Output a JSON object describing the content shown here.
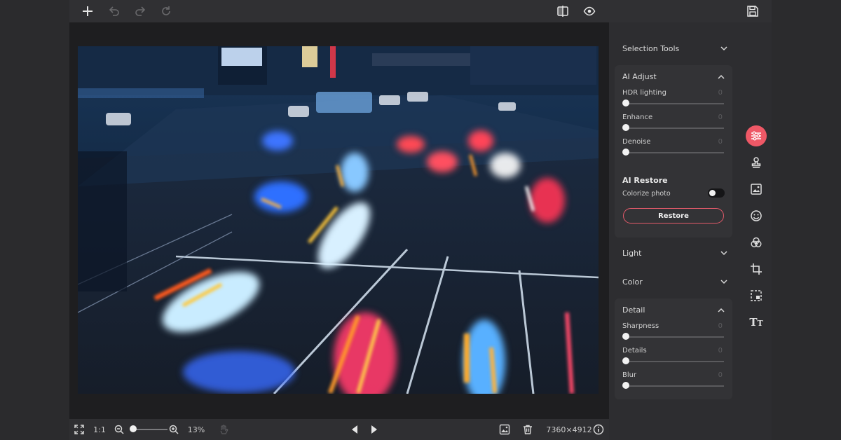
{
  "panel": {
    "selection_tools": "Selection Tools",
    "ai_adjust": {
      "title": "AI Adjust",
      "sliders": [
        {
          "label": "HDR lighting",
          "value": "0"
        },
        {
          "label": "Enhance",
          "value": "0"
        },
        {
          "label": "Denoise",
          "value": "0"
        }
      ]
    },
    "ai_restore": {
      "title": "AI Restore",
      "colorize_label": "Colorize photo",
      "restore_label": "Restore"
    },
    "light": "Light",
    "color": "Color",
    "detail": {
      "title": "Detail",
      "sliders": [
        {
          "label": "Sharpness",
          "value": "0"
        },
        {
          "label": "Details",
          "value": "0"
        },
        {
          "label": "Blur",
          "value": "0"
        }
      ]
    }
  },
  "bottom": {
    "ratio_label": "1:1",
    "zoom_value": "13%",
    "image_size": "7360×4912"
  },
  "colors": {
    "accent": "#ee5866",
    "panel_bg": "#2d2d30",
    "card_bg": "#333336"
  },
  "icons": {
    "top": [
      "plus-icon",
      "undo-icon",
      "redo-icon",
      "reset-icon",
      "compare-icon",
      "eye-icon",
      "save-icon"
    ],
    "rail": [
      "adjust-sliders-icon",
      "stamp-icon",
      "image-replace-icon",
      "face-icon",
      "color-circles-icon",
      "crop-icon",
      "frame-icon",
      "text-icon"
    ]
  }
}
